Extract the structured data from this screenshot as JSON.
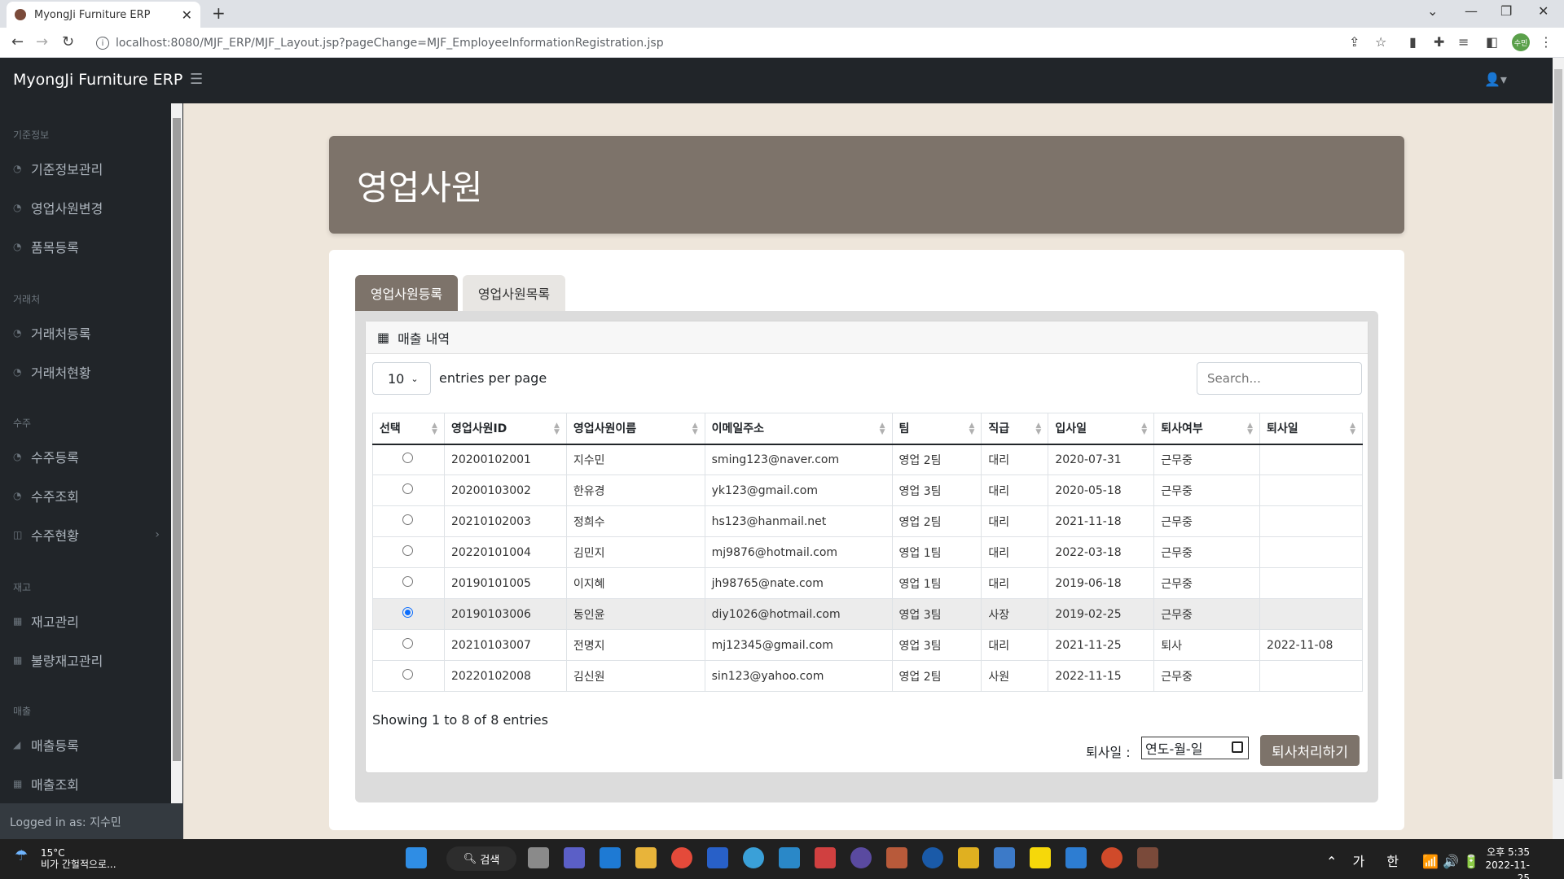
{
  "browser": {
    "tab_title": "MyongJi Furniture ERP",
    "url": "localhost:8080/MJF_ERP/MJF_Layout.jsp?pageChange=MJF_EmployeeInformationRegistration.jsp",
    "profile_initials": "수민"
  },
  "app": {
    "brand": "MyongJi Furniture ERP"
  },
  "sidebar": {
    "sections": [
      {
        "heading": "기준정보",
        "items": [
          {
            "label": "기준정보관리",
            "icon": "gauge-icon"
          },
          {
            "label": "영업사원변경",
            "icon": "gauge-icon"
          },
          {
            "label": "품목등록",
            "icon": "gauge-icon"
          }
        ]
      },
      {
        "heading": "거래처",
        "items": [
          {
            "label": "거래처등록",
            "icon": "gauge-icon"
          },
          {
            "label": "거래처현황",
            "icon": "gauge-icon"
          }
        ]
      },
      {
        "heading": "수주",
        "items": [
          {
            "label": "수주등록",
            "icon": "gauge-icon"
          },
          {
            "label": "수주조회",
            "icon": "gauge-icon"
          },
          {
            "label": "수주현황",
            "icon": "columns-icon"
          }
        ]
      },
      {
        "heading": "재고",
        "items": [
          {
            "label": "재고관리",
            "icon": "table-icon"
          },
          {
            "label": "불량재고관리",
            "icon": "table-icon"
          }
        ]
      },
      {
        "heading": "매출",
        "items": [
          {
            "label": "매출등록",
            "icon": "chart-area-icon"
          },
          {
            "label": "매출조회",
            "icon": "table-icon"
          }
        ]
      }
    ],
    "footer": "Logged in as: 지수민"
  },
  "page": {
    "title": "영업사원",
    "tabs": [
      "영업사원등록",
      "영업사원목록"
    ],
    "card_title": "매출 내역",
    "page_length": "10",
    "page_length_label": "entries per page",
    "search_placeholder": "Search...",
    "columns": [
      "선택",
      "영업사원ID",
      "영업사원이름",
      "이메일주소",
      "팀",
      "직급",
      "입사일",
      "퇴사여부",
      "퇴사일"
    ],
    "rows": [
      {
        "id": "20200102001",
        "name": "지수민",
        "email": "sming123@naver.com",
        "team": "영업 2팀",
        "rank": "대리",
        "hired": "2020-07-31",
        "status": "근무중",
        "retired": "",
        "selected": false
      },
      {
        "id": "20200103002",
        "name": "한유경",
        "email": "yk123@gmail.com",
        "team": "영업 3팀",
        "rank": "대리",
        "hired": "2020-05-18",
        "status": "근무중",
        "retired": "",
        "selected": false
      },
      {
        "id": "20210102003",
        "name": "정희수",
        "email": "hs123@hanmail.net",
        "team": "영업 2팀",
        "rank": "대리",
        "hired": "2021-11-18",
        "status": "근무중",
        "retired": "",
        "selected": false
      },
      {
        "id": "20220101004",
        "name": "김민지",
        "email": "mj9876@hotmail.com",
        "team": "영업 1팀",
        "rank": "대리",
        "hired": "2022-03-18",
        "status": "근무중",
        "retired": "",
        "selected": false
      },
      {
        "id": "20190101005",
        "name": "이지혜",
        "email": "jh98765@nate.com",
        "team": "영업 1팀",
        "rank": "대리",
        "hired": "2019-06-18",
        "status": "근무중",
        "retired": "",
        "selected": false
      },
      {
        "id": "20190103006",
        "name": "동인윤",
        "email": "diy1026@hotmail.com",
        "team": "영업 3팀",
        "rank": "사장",
        "hired": "2019-02-25",
        "status": "근무중",
        "retired": "",
        "selected": true
      },
      {
        "id": "20210103007",
        "name": "전명지",
        "email": "mj12345@gmail.com",
        "team": "영업 3팀",
        "rank": "대리",
        "hired": "2021-11-25",
        "status": "퇴사",
        "retired": "2022-11-08",
        "selected": false
      },
      {
        "id": "20220102008",
        "name": "김신원",
        "email": "sin123@yahoo.com",
        "team": "영업 2팀",
        "rank": "사원",
        "hired": "2022-11-15",
        "status": "근무중",
        "retired": "",
        "selected": false
      }
    ],
    "info": "Showing 1 to 8 of 8 entries",
    "retire_label": "퇴사일 :",
    "date_placeholder": "연도-월-일",
    "retire_button": "퇴사처리하기"
  },
  "taskbar": {
    "temp": "15°C",
    "weather": "비가 간헐적으로...",
    "search": "검색",
    "ime1": "가",
    "ime2": "한",
    "time": "오후 5:35",
    "date": "2022-11-25"
  }
}
